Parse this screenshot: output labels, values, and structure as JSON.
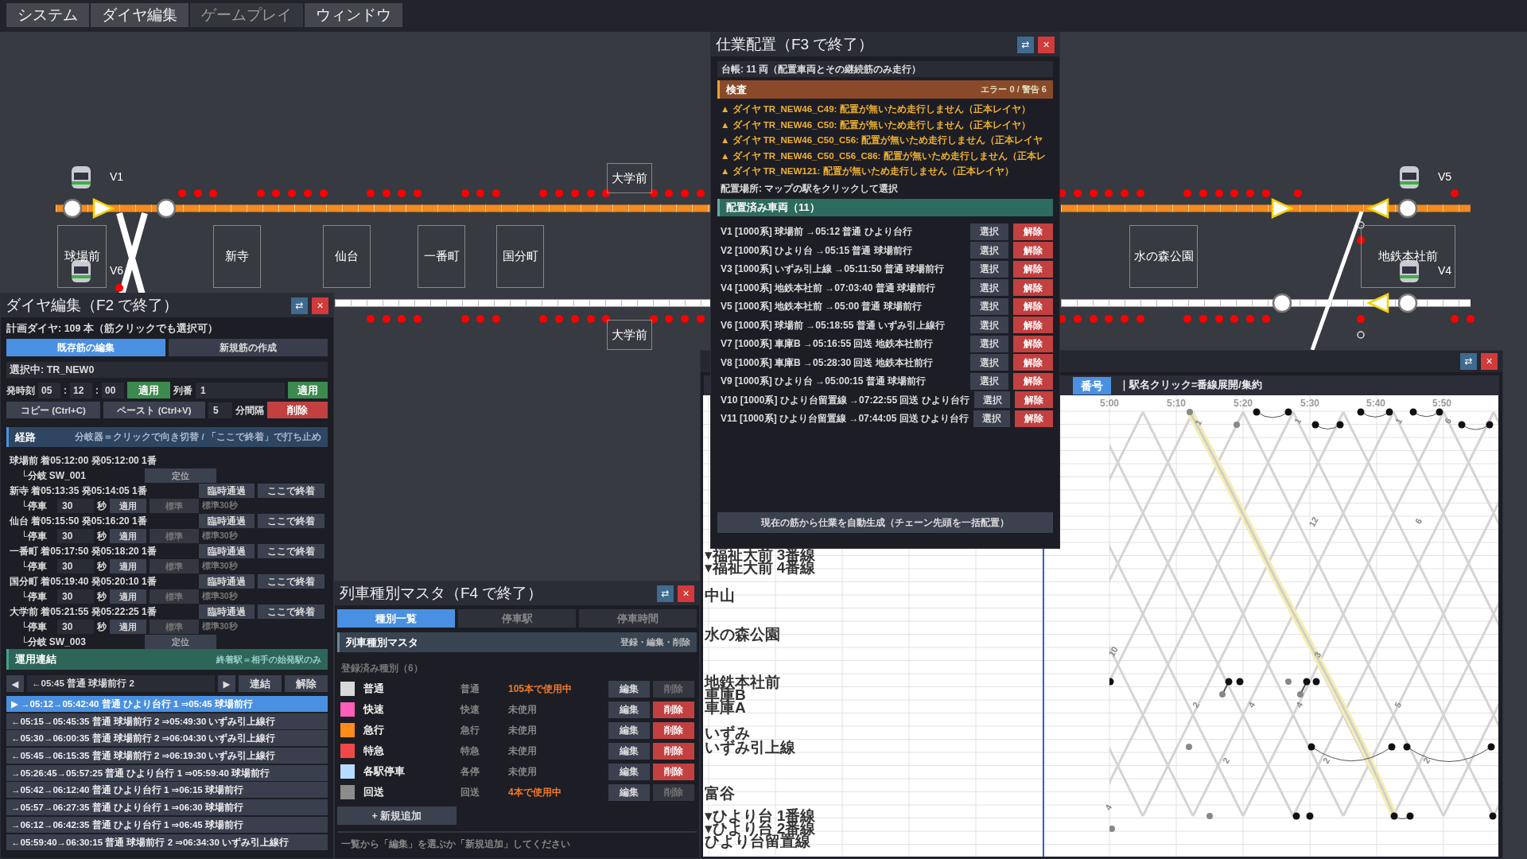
{
  "menu": [
    {
      "label": "システム",
      "disabled": false
    },
    {
      "label": "ダイヤ編集",
      "disabled": false
    },
    {
      "label": "ゲームプレイ",
      "disabled": true
    },
    {
      "label": "ウィンドウ",
      "disabled": false
    }
  ],
  "map": {
    "stations": [
      {
        "name": "球場前"
      },
      {
        "name": "新寺"
      },
      {
        "name": "仙台"
      },
      {
        "name": "一番町"
      },
      {
        "name": "国分町"
      },
      {
        "name": "大学前"
      },
      {
        "name": "大学前"
      },
      {
        "name": "水の森公園"
      },
      {
        "name": "地鉄本社前"
      }
    ],
    "vehicles": [
      {
        "label": "V1"
      },
      {
        "label": "V6"
      },
      {
        "label": "V5"
      },
      {
        "label": "V4"
      }
    ]
  },
  "dia_editor": {
    "title": "ダイヤ編集（F2 で終了）",
    "swap": "⇄",
    "close": "×",
    "summary": "計画ダイヤ: 109 本（筋クリックでも選択可）",
    "tabs": [
      {
        "label": "既存筋の編集",
        "selected": true
      },
      {
        "label": "新規筋の作成",
        "selected": false
      }
    ],
    "selection": "選択中: TR_NEW0",
    "departure": {
      "label": "発時刻",
      "fields": [
        "05",
        "12",
        "00"
      ],
      "separators": [
        ":",
        ":"
      ],
      "apply": "適用",
      "number_label": "列番",
      "number": "1",
      "number_apply": "適用"
    },
    "copy": "コピー (Ctrl+C)",
    "paste": "ペースト (Ctrl+V)",
    "interval": "5",
    "interval_unit": "分間隔",
    "delete": "削除",
    "route": {
      "title": "経路",
      "hint": "分岐器＝クリックで向き切替 / 「ここで終着」で打ち止め",
      "rows": [
        {
          "kind": "station",
          "text": "球場前 着05:12:00 発05:12:00 1番"
        },
        {
          "kind": "branch",
          "label": "└分岐 SW_001",
          "state": "定位"
        },
        {
          "kind": "station",
          "text": "新寺 着05:13:35 発05:14:05 1番",
          "pass": "臨時通過",
          "end": "ここで終着"
        },
        {
          "kind": "dwell",
          "label": "└停車",
          "value": "30",
          "unit": "秒",
          "apply": "適用",
          "standard": "標準",
          "note": "標準30秒"
        },
        {
          "kind": "station",
          "text": "仙台 着05:15:50 発05:16:20 1番",
          "pass": "臨時通過",
          "end": "ここで終着"
        },
        {
          "kind": "dwell",
          "label": "└停車",
          "value": "30",
          "unit": "秒",
          "apply": "適用",
          "standard": "標準",
          "note": "標準30秒"
        },
        {
          "kind": "station",
          "text": "一番町 着05:17:50 発05:18:20 1番",
          "pass": "臨時通過",
          "end": "ここで終着"
        },
        {
          "kind": "dwell",
          "label": "└停車",
          "value": "30",
          "unit": "秒",
          "apply": "適用",
          "standard": "標準",
          "note": "標準30秒"
        },
        {
          "kind": "station",
          "text": "国分町 着05:19:40 発05:20:10 1番",
          "pass": "臨時通過",
          "end": "ここで終着"
        },
        {
          "kind": "dwell",
          "label": "└停車",
          "value": "30",
          "unit": "秒",
          "apply": "適用",
          "standard": "標準",
          "note": "標準30秒"
        },
        {
          "kind": "station",
          "text": "大学前 着05:21:55 発05:22:25 1番",
          "pass": "臨時通過",
          "end": "ここで終着"
        },
        {
          "kind": "dwell",
          "label": "└停車",
          "value": "30",
          "unit": "秒",
          "apply": "適用",
          "standard": "標準",
          "note": "標準30秒"
        },
        {
          "kind": "branch",
          "label": "└分岐 SW_003",
          "state": "定位"
        }
      ]
    },
    "link": {
      "title": "運用連結",
      "hint": "終着駅＝相手の始発駅のみ",
      "prev": "◀",
      "current": "←05:45 普通 球場前行 2",
      "next": "▶",
      "connect": "連結",
      "release": "解除"
    },
    "chains": [
      {
        "text": "▶ →05:12→05:42:40 普通 ひより台行 1 ⇒05:45 球場前行",
        "selected": true
      },
      {
        "text": "←05:15→05:45:35 普通 球場前行 2 ⇒05:49:30 いずみ引上線行",
        "selected": false
      },
      {
        "text": "←05:30→06:00:35 普通 球場前行 2 ⇒06:04:30 いずみ引上線行",
        "selected": false
      },
      {
        "text": "←05:45→06:15:35 普通 球場前行 2 ⇒06:19:30 いずみ引上線行",
        "selected": false
      },
      {
        "text": "→05:26:45→05:57:25 普通 ひより台行 1 ⇒05:59:40 球場前行",
        "selected": false
      },
      {
        "text": "→05:42→06:12:40 普通 ひより台行 1 ⇒06:15 球場前行",
        "selected": false
      },
      {
        "text": "→05:57→06:27:35 普通 ひより台行 1 ⇒06:30 球場前行",
        "selected": false
      },
      {
        "text": "→06:12→06:42:35 普通 ひより台行 1 ⇒06:45 球場前行",
        "selected": false
      },
      {
        "text": "←05:59:40→06:30:15 普通 球場前行 2 ⇒06:34:30 いずみ引上線行",
        "selected": false
      }
    ]
  },
  "assignment": {
    "title": "仕業配置（F3 で終了）",
    "swap": "⇄",
    "close": "×",
    "ledger": "台帳: 11 両（配置車両とその継続筋のみ走行）",
    "inspection": {
      "title": "検査",
      "summary": "エラー 0 / 警告 6",
      "warnings": [
        "▲ ダイヤ TR_NEW46_C49: 配置が無いため走行しません（正本レイヤ）",
        "▲ ダイヤ TR_NEW46_C50: 配置が無いため走行しません（正本レイヤ）",
        "▲ ダイヤ TR_NEW46_C50_C56: 配置が無いため走行しません（正本レイヤ",
        "▲ ダイヤ TR_NEW46_C50_C56_C86: 配置が無いため走行しません（正本レ",
        "▲ ダイヤ TR_NEW121: 配置が無いため走行しません（正本レイヤ）"
      ]
    },
    "placement": "配置場所: マップの駅をクリックして選択",
    "assigned": {
      "title": "配置済み車両（11）",
      "vehicles": [
        {
          "text": "V1 [1000系] 球場前 →05:12 普通 ひより台行",
          "select": "選択",
          "release": "解除"
        },
        {
          "text": "V2 [1000系] ひより台 →05:15 普通 球場前行",
          "select": "選択",
          "release": "解除"
        },
        {
          "text": "V3 [1000系] いずみ引上線 →05:11:50 普通 球場前行",
          "select": "選択",
          "release": "解除"
        },
        {
          "text": "V4 [1000系] 地鉄本社前 →07:03:40 普通 球場前行",
          "select": "選択",
          "release": "解除"
        },
        {
          "text": "V5 [1000系] 地鉄本社前 →05:00 普通 球場前行",
          "select": "選択",
          "release": "解除"
        },
        {
          "text": "V6 [1000系] 球場前 →05:18:55 普通 いずみ引上線行",
          "select": "選択",
          "release": "解除"
        },
        {
          "text": "V7 [1000系] 車庫B →05:16:55 回送 地鉄本社前行",
          "select": "選択",
          "release": "解除"
        },
        {
          "text": "V8 [1000系] 車庫B →05:28:30 回送 地鉄本社前行",
          "select": "選択",
          "release": "解除"
        },
        {
          "text": "V9 [1000系] ひより台 →05:00:15 普通 球場前行",
          "select": "選択",
          "release": "解除"
        },
        {
          "text": "V10 [1000系] ひより台留置線 →07:22:55 回送 ひより台行",
          "select": "選択",
          "release": "解除"
        },
        {
          "text": "V11 [1000系] ひより台留置線 →07:44:05 回送 ひより台行",
          "select": "選択",
          "release": "解除"
        }
      ]
    },
    "auto": "現在の筋から仕業を自動生成（チェーン先頭を一括配置）"
  },
  "train_types": {
    "title": "列車種別マスタ（F4 で終了）",
    "swap": "⇄",
    "close": "×",
    "tabs": [
      {
        "label": "種別一覧",
        "selected": true
      },
      {
        "label": "停車駅",
        "selected": false
      },
      {
        "label": "停車時間",
        "selected": false
      }
    ],
    "section": {
      "title": "列車種別マスタ",
      "hint": "登録・編集・削除"
    },
    "count": "登録済み種別（6）",
    "types": [
      {
        "name": "普通",
        "short": "普通",
        "usage": "105本で使用中",
        "in_use": true,
        "color": "#d9d9d9",
        "edit": "編集",
        "delete": "削除"
      },
      {
        "name": "快速",
        "short": "快速",
        "usage": "未使用",
        "in_use": false,
        "color": "#ff5fb8",
        "edit": "編集",
        "delete": "削除"
      },
      {
        "name": "急行",
        "short": "急行",
        "usage": "未使用",
        "in_use": false,
        "color": "#ff8c1a",
        "edit": "編集",
        "delete": "削除"
      },
      {
        "name": "特急",
        "short": "特急",
        "usage": "未使用",
        "in_use": false,
        "color": "#f04848",
        "edit": "編集",
        "delete": "削除"
      },
      {
        "name": "各駅停車",
        "short": "各停",
        "usage": "未使用",
        "in_use": false,
        "color": "#b8dcff",
        "edit": "編集",
        "delete": "削除"
      },
      {
        "name": "回送",
        "short": "回送",
        "usage": "4本で使用中",
        "in_use": true,
        "color": "#8c8c8c",
        "edit": "編集",
        "delete": "削除"
      }
    ],
    "add": "+ 新規追加",
    "footer": "一覧から「編集」を選ぶか「新規追加」してください"
  },
  "diagram": {
    "swap": "⇄",
    "close": "×",
    "mode": {
      "label": "番号",
      "selected": true
    },
    "hint": "｜駅名クリック=番線展開/集約",
    "time_labels": [
      "5:00",
      "5:10",
      "5:20",
      "5:30",
      "5:40",
      "5:50"
    ],
    "stations": [
      "▾福祉大前 3番線",
      "▾福祉大前 4番線",
      "中山",
      "水の森公園",
      "地鉄本社前",
      "車庫B",
      "車庫A",
      "いずみ",
      "いずみ引上線",
      "富谷",
      "▾ひより台 1番線",
      "▾ひより台 2番線",
      "ひより台留置線"
    ],
    "line_labels": [
      "1",
      "1",
      "1",
      "6",
      "12",
      "6",
      "10",
      "3",
      "2",
      "4",
      "4",
      "5",
      "2",
      "2",
      "2",
      "4"
    ]
  }
}
